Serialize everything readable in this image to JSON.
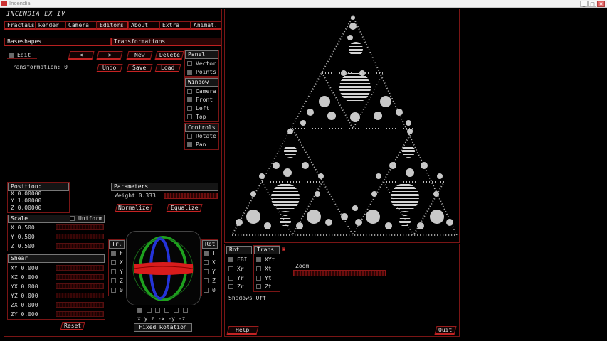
{
  "window": {
    "title": "Incendia",
    "controls": {
      "minimize": "_",
      "maximize": "□",
      "close": "✕"
    }
  },
  "app": {
    "name": "INCENDIA EX IV"
  },
  "menu": [
    "Fractals",
    "Render",
    "Camera",
    "Editors",
    "About",
    "Extra",
    "Animat."
  ],
  "subtabs": [
    "Baseshapes",
    "Transformations"
  ],
  "editor": {
    "edit_label": "Edit",
    "transformation_label": "Transformation: 0",
    "prev": "<",
    "next": ">",
    "new": "New",
    "delete": "Delete",
    "undo": "Undo",
    "save": "Save",
    "load": "Load"
  },
  "panel_box": {
    "title": "Panel",
    "items": [
      {
        "label": "Vector",
        "on": false
      },
      {
        "label": "Points",
        "on": true
      }
    ]
  },
  "window_box": {
    "title": "Window",
    "items": [
      {
        "label": "Camera",
        "on": false
      },
      {
        "label": "Front",
        "on": true
      },
      {
        "label": "Left",
        "on": false
      },
      {
        "label": "Top",
        "on": false
      }
    ]
  },
  "controls_box": {
    "title": "Controls",
    "items": [
      {
        "label": "Rotate",
        "on": false
      },
      {
        "label": "Pan",
        "on": true
      }
    ]
  },
  "position": {
    "title": "Position:",
    "x": "X    0.00000",
    "y": "Y    1.00000",
    "z": "Z    0.00000"
  },
  "parameters": {
    "title": "Parameters",
    "weight": "Weight  0.333",
    "normalize": "Normalize",
    "equalize": "Equalize"
  },
  "scale": {
    "title": "Scale",
    "uniform": "Uniform",
    "rows": [
      "X     0.500",
      "Y     0.500",
      "Z     0.500"
    ]
  },
  "shear": {
    "title": "Shear",
    "rows": [
      "XY    0.000",
      "XZ    0.000",
      "YX    0.000",
      "YZ    0.000",
      "ZX    0.000",
      "ZY    0.000"
    ]
  },
  "reset": "Reset",
  "tr_box": {
    "title": "Tr.",
    "items": [
      "F",
      "X",
      "Y",
      "Z",
      "0"
    ]
  },
  "rot_box": {
    "title": "Rot",
    "items": [
      "T",
      "X",
      "Y",
      "Z",
      "0"
    ]
  },
  "axis_labels": "x  y  z  -x -y -z",
  "fixed_rotation": "Fixed Rotation",
  "bottom": {
    "rot_title": "Rot",
    "rot_items": [
      "FBI",
      "Xr",
      "Yr",
      "Zr"
    ],
    "trans_title": "Trans",
    "trans_items": [
      "XYt",
      "Xt",
      "Yt",
      "Zt"
    ],
    "zoom": "Zoom",
    "shadows": "Shadows  Off",
    "help": "Help",
    "quit": "Quit"
  },
  "colors": {
    "accent": "#b81e1e",
    "bg": "#000000",
    "fractal": "#d0d0d0"
  }
}
